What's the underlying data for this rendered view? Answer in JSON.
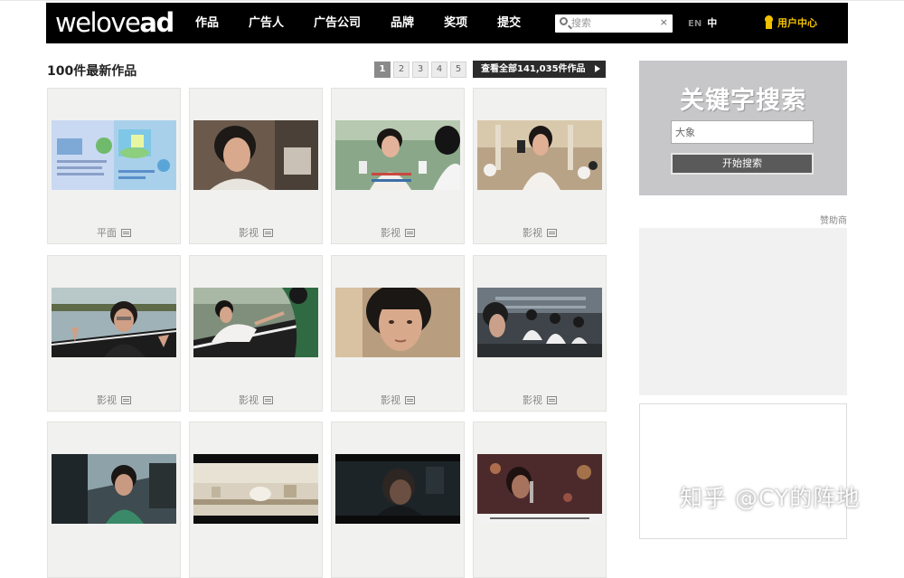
{
  "nav": {
    "logo_main": "welove",
    "logo_ad": "ad",
    "items": [
      {
        "label": "作品"
      },
      {
        "label": "广告人"
      },
      {
        "label": "广告公司"
      },
      {
        "label": "品牌"
      },
      {
        "label": "奖项"
      },
      {
        "label": "提交"
      }
    ],
    "search_placeholder": "搜索",
    "search_clear": "×",
    "lang_en": "EN",
    "lang_zh": "中",
    "user_center": "用户中心"
  },
  "section": {
    "title": "100件最新作品",
    "pages": [
      "1",
      "2",
      "3",
      "4",
      "5"
    ],
    "active_page": "1",
    "view_all": "查看全部141,035件作品"
  },
  "works": [
    {
      "label": "平面",
      "icon": "list-icon"
    },
    {
      "label": "影视",
      "icon": "list-icon"
    },
    {
      "label": "影视",
      "icon": "list-icon"
    },
    {
      "label": "影视",
      "icon": "list-icon"
    },
    {
      "label": "影视",
      "icon": "list-icon"
    },
    {
      "label": "影视",
      "icon": "list-icon"
    },
    {
      "label": "影视",
      "icon": "list-icon"
    },
    {
      "label": "影视",
      "icon": "list-icon"
    },
    {
      "label": "",
      "icon": ""
    },
    {
      "label": "",
      "icon": ""
    },
    {
      "label": "",
      "icon": ""
    },
    {
      "label": "",
      "icon": ""
    }
  ],
  "sidebar": {
    "keyword_title": "关键字搜索",
    "keyword_value": "大象",
    "search_button": "开始搜索",
    "sponsor_label": "赞助商"
  },
  "watermark": "知乎 @CY的阵地",
  "colors": {
    "nav_bg": "#000000",
    "accent_yellow": "#f2c200",
    "card_bg": "#f1f1ef",
    "keyword_box_bg": "#c7c7c9"
  }
}
